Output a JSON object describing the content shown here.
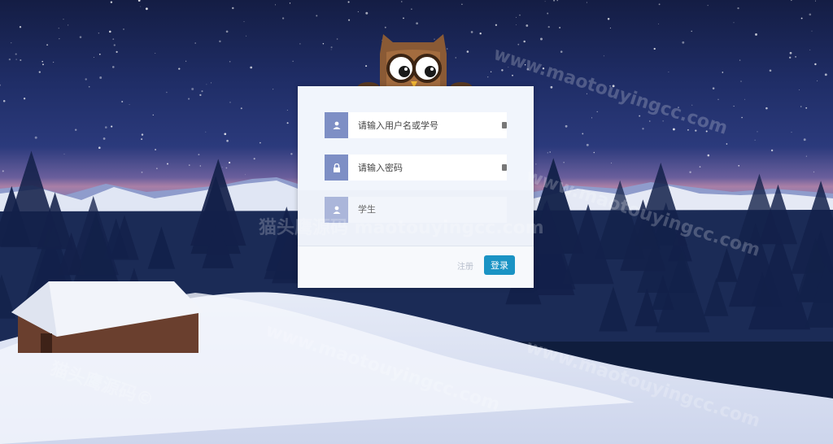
{
  "login": {
    "username_placeholder": "请输入用户名或学号",
    "password_placeholder": "请输入密码",
    "role_selected": "学生",
    "register_label": "注册",
    "login_label": "登录"
  },
  "icons": {
    "username": "user-icon",
    "password": "lock-icon",
    "role": "user-icon",
    "mascot": "owl-icon"
  },
  "watermarks": [
    "猫头鹰源码 maotouyingcc.com",
    "www.maotouyingcc.com",
    "猫头鹰源码©",
    "www.maotouyingcc.com",
    "www.maotouyingcc.com",
    "www.maotouyingcc.com"
  ],
  "colors": {
    "icon_box": "#7e8fc5",
    "login_button": "#1a93c4",
    "panel": "#eef2f8"
  }
}
